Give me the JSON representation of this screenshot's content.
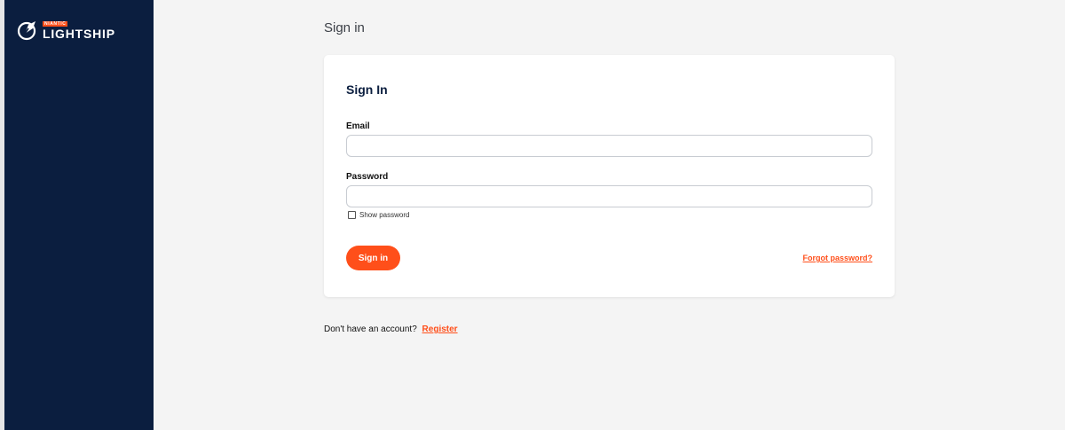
{
  "sidebar": {
    "logo": {
      "badge": "NIANTIC",
      "name": "LIGHTSHIP",
      "icon": "lightship-logo-icon"
    }
  },
  "page": {
    "title": "Sign in"
  },
  "card": {
    "title": "Sign In",
    "email": {
      "label": "Email",
      "value": "",
      "placeholder": ""
    },
    "password": {
      "label": "Password",
      "value": "",
      "placeholder": ""
    },
    "show_password": {
      "label": "Show password",
      "checked": false
    },
    "signin_button": "Sign in",
    "forgot_link": "Forgot password?"
  },
  "register": {
    "prompt": "Don't have an account?",
    "link": "Register"
  },
  "colors": {
    "sidebar": "#0b1e3f",
    "accent": "#ff4f1a",
    "background": "#f4f4f4",
    "card": "#ffffff"
  }
}
